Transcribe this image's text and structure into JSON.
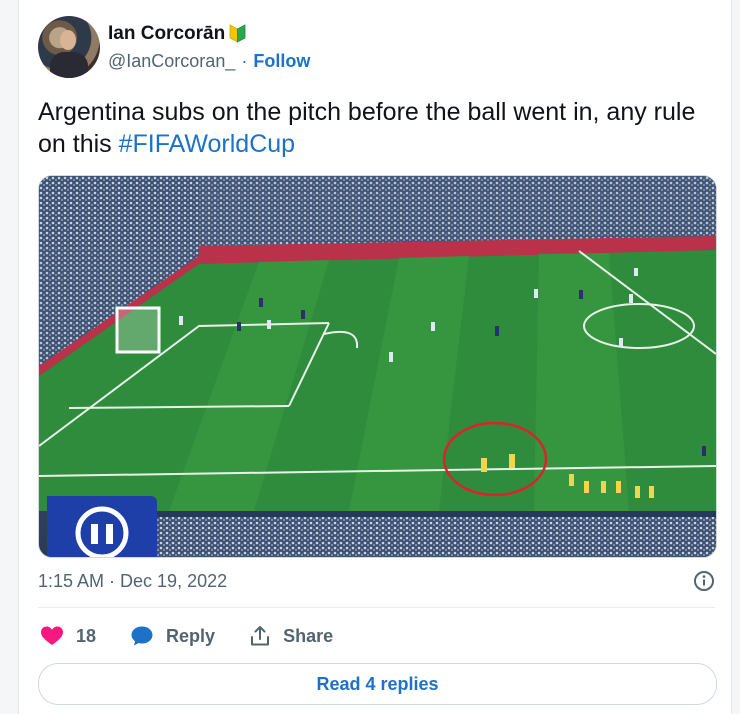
{
  "author": {
    "display_name": "Ian Corcorān",
    "handle": "@IanCorcoran_",
    "separator": "·",
    "follow_label": "Follow",
    "badge_icon": "beginner-leaf-icon"
  },
  "tweet": {
    "text_main": "Argentina subs on the pitch before the ball went in, any rule on this ",
    "hashtag": "#FIFAWorldCup"
  },
  "media": {
    "overlay_icon": "pause-icon"
  },
  "meta": {
    "timestamp": "1:15 AM · Dec 19, 2022",
    "info_icon": "info-icon"
  },
  "actions": {
    "like_count": "18",
    "reply_label": "Reply",
    "share_label": "Share"
  },
  "footer": {
    "read_replies_label": "Read 4 replies"
  },
  "colors": {
    "accent": "#1d72c8",
    "like": "#f91880",
    "text_secondary": "#536471",
    "highlight_circle": "#d9242b"
  }
}
